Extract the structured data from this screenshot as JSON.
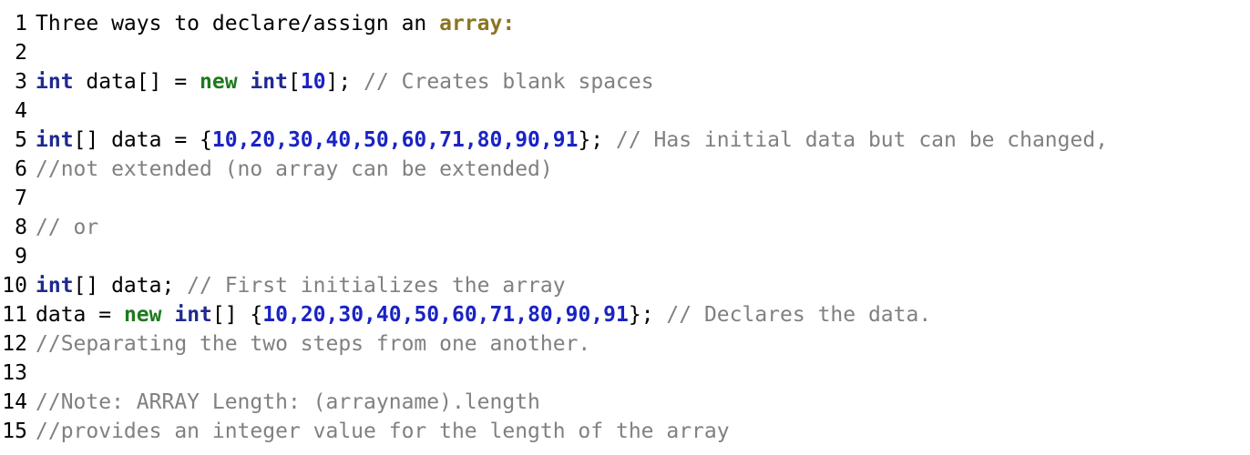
{
  "editor": {
    "lines": [
      {
        "n": "1",
        "tokens": [
          {
            "t": "Three ways to declare/assign an ",
            "c": "plain"
          },
          {
            "t": "array:",
            "c": "highlight"
          }
        ]
      },
      {
        "n": "2",
        "tokens": []
      },
      {
        "n": "3",
        "tokens": [
          {
            "t": "int",
            "c": "kw-type"
          },
          {
            "t": " data[] = ",
            "c": "plain"
          },
          {
            "t": "new",
            "c": "kw-new"
          },
          {
            "t": " ",
            "c": "plain"
          },
          {
            "t": "int",
            "c": "kw-type"
          },
          {
            "t": "[",
            "c": "plain"
          },
          {
            "t": "10",
            "c": "num"
          },
          {
            "t": "]; ",
            "c": "plain"
          },
          {
            "t": "// Creates blank spaces",
            "c": "comment"
          }
        ]
      },
      {
        "n": "4",
        "tokens": []
      },
      {
        "n": "5",
        "tokens": [
          {
            "t": "int",
            "c": "kw-type"
          },
          {
            "t": "[] data = {",
            "c": "plain"
          },
          {
            "t": "10,20,30,40,50,60,71,80,90,91",
            "c": "num"
          },
          {
            "t": "}; ",
            "c": "plain"
          },
          {
            "t": "// Has initial data but can be changed,",
            "c": "comment"
          }
        ]
      },
      {
        "n": "6",
        "tokens": [
          {
            "t": "//not extended (no array can be extended)",
            "c": "comment"
          }
        ]
      },
      {
        "n": "7",
        "tokens": []
      },
      {
        "n": "8",
        "tokens": [
          {
            "t": "// or",
            "c": "comment"
          }
        ]
      },
      {
        "n": "9",
        "tokens": []
      },
      {
        "n": "10",
        "tokens": [
          {
            "t": "int",
            "c": "kw-type"
          },
          {
            "t": "[] data; ",
            "c": "plain"
          },
          {
            "t": "// First initializes the array",
            "c": "comment"
          }
        ]
      },
      {
        "n": "11",
        "tokens": [
          {
            "t": "data = ",
            "c": "plain"
          },
          {
            "t": "new",
            "c": "kw-new"
          },
          {
            "t": " ",
            "c": "plain"
          },
          {
            "t": "int",
            "c": "kw-type"
          },
          {
            "t": "[] {",
            "c": "plain"
          },
          {
            "t": "10,20,30,40,50,60,71,80,90,91",
            "c": "num"
          },
          {
            "t": "}; ",
            "c": "plain"
          },
          {
            "t": "// Declares the data.",
            "c": "comment"
          }
        ]
      },
      {
        "n": "12",
        "tokens": [
          {
            "t": "//Separating the two steps from one another.",
            "c": "comment"
          }
        ]
      },
      {
        "n": "13",
        "tokens": []
      },
      {
        "n": "14",
        "tokens": [
          {
            "t": "//Note: ARRAY Length: (arrayname).length",
            "c": "comment"
          }
        ]
      },
      {
        "n": "15",
        "tokens": [
          {
            "t": "//provides an integer value for the length of the array",
            "c": "comment"
          }
        ]
      }
    ]
  }
}
